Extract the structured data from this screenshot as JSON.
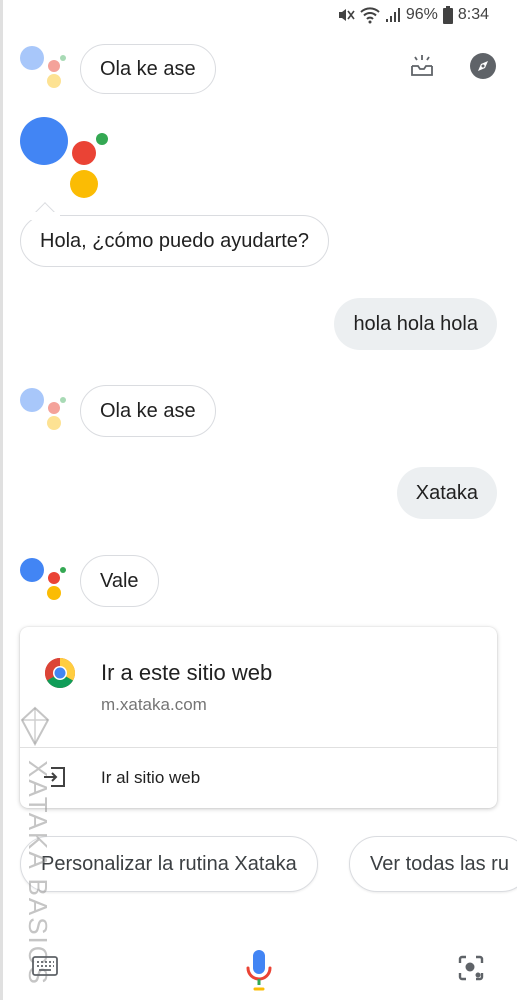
{
  "status_bar": {
    "battery": "96%",
    "time": "8:34"
  },
  "top_icons": [
    "updates-tray-icon",
    "explore-compass-icon"
  ],
  "conversation": {
    "assistant_reply_1": "Ola ke ase",
    "greeting": "Hola, ¿cómo puedo ayudarte?",
    "user_message_1": "hola hola hola",
    "assistant_reply_2": "Ola ke ase",
    "user_message_2": "Xataka",
    "assistant_reply_3": "Vale"
  },
  "website_card": {
    "title": "Ir a este sitio web",
    "url": "m.xataka.com",
    "action_label": "Ir al sitio web"
  },
  "suggestion_chips": [
    "Personalizar la rutina Xataka",
    "Ver todas las ru"
  ],
  "watermark": "XATAKA BASICS",
  "bottom_bar": {
    "icons": [
      "keyboard-icon",
      "microphone-icon",
      "lens-icon"
    ]
  },
  "colors": {
    "google_blue": "#4285f4",
    "google_red": "#ea4335",
    "google_yellow": "#fbbc04",
    "google_green": "#34a853",
    "user_bubble": "#eceff1",
    "border": "#dadce0"
  }
}
